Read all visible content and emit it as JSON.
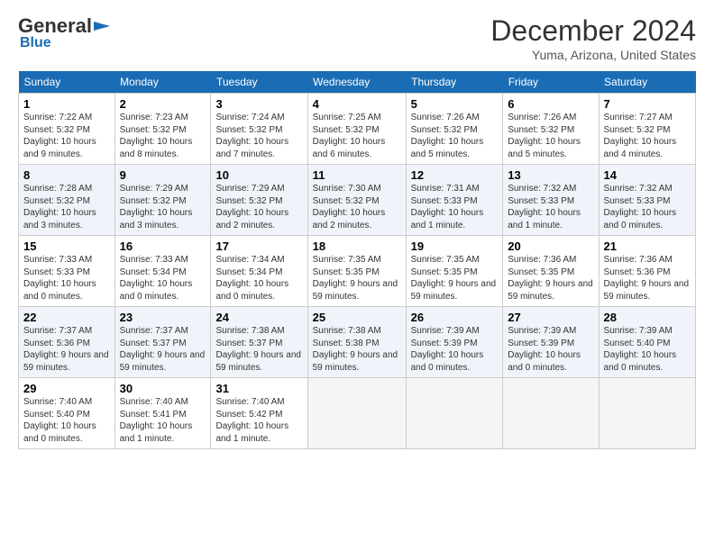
{
  "logo": {
    "general": "General",
    "blue": "Blue"
  },
  "title": "December 2024",
  "location": "Yuma, Arizona, United States",
  "days_of_week": [
    "Sunday",
    "Monday",
    "Tuesday",
    "Wednesday",
    "Thursday",
    "Friday",
    "Saturday"
  ],
  "weeks": [
    [
      {
        "day": "1",
        "sunrise": "7:22 AM",
        "sunset": "5:32 PM",
        "daylight": "10 hours and 9 minutes."
      },
      {
        "day": "2",
        "sunrise": "7:23 AM",
        "sunset": "5:32 PM",
        "daylight": "10 hours and 8 minutes."
      },
      {
        "day": "3",
        "sunrise": "7:24 AM",
        "sunset": "5:32 PM",
        "daylight": "10 hours and 7 minutes."
      },
      {
        "day": "4",
        "sunrise": "7:25 AM",
        "sunset": "5:32 PM",
        "daylight": "10 hours and 6 minutes."
      },
      {
        "day": "5",
        "sunrise": "7:26 AM",
        "sunset": "5:32 PM",
        "daylight": "10 hours and 5 minutes."
      },
      {
        "day": "6",
        "sunrise": "7:26 AM",
        "sunset": "5:32 PM",
        "daylight": "10 hours and 5 minutes."
      },
      {
        "day": "7",
        "sunrise": "7:27 AM",
        "sunset": "5:32 PM",
        "daylight": "10 hours and 4 minutes."
      }
    ],
    [
      {
        "day": "8",
        "sunrise": "7:28 AM",
        "sunset": "5:32 PM",
        "daylight": "10 hours and 3 minutes."
      },
      {
        "day": "9",
        "sunrise": "7:29 AM",
        "sunset": "5:32 PM",
        "daylight": "10 hours and 3 minutes."
      },
      {
        "day": "10",
        "sunrise": "7:29 AM",
        "sunset": "5:32 PM",
        "daylight": "10 hours and 2 minutes."
      },
      {
        "day": "11",
        "sunrise": "7:30 AM",
        "sunset": "5:32 PM",
        "daylight": "10 hours and 2 minutes."
      },
      {
        "day": "12",
        "sunrise": "7:31 AM",
        "sunset": "5:33 PM",
        "daylight": "10 hours and 1 minute."
      },
      {
        "day": "13",
        "sunrise": "7:32 AM",
        "sunset": "5:33 PM",
        "daylight": "10 hours and 1 minute."
      },
      {
        "day": "14",
        "sunrise": "7:32 AM",
        "sunset": "5:33 PM",
        "daylight": "10 hours and 0 minutes."
      }
    ],
    [
      {
        "day": "15",
        "sunrise": "7:33 AM",
        "sunset": "5:33 PM",
        "daylight": "10 hours and 0 minutes."
      },
      {
        "day": "16",
        "sunrise": "7:33 AM",
        "sunset": "5:34 PM",
        "daylight": "10 hours and 0 minutes."
      },
      {
        "day": "17",
        "sunrise": "7:34 AM",
        "sunset": "5:34 PM",
        "daylight": "10 hours and 0 minutes."
      },
      {
        "day": "18",
        "sunrise": "7:35 AM",
        "sunset": "5:35 PM",
        "daylight": "9 hours and 59 minutes."
      },
      {
        "day": "19",
        "sunrise": "7:35 AM",
        "sunset": "5:35 PM",
        "daylight": "9 hours and 59 minutes."
      },
      {
        "day": "20",
        "sunrise": "7:36 AM",
        "sunset": "5:35 PM",
        "daylight": "9 hours and 59 minutes."
      },
      {
        "day": "21",
        "sunrise": "7:36 AM",
        "sunset": "5:36 PM",
        "daylight": "9 hours and 59 minutes."
      }
    ],
    [
      {
        "day": "22",
        "sunrise": "7:37 AM",
        "sunset": "5:36 PM",
        "daylight": "9 hours and 59 minutes."
      },
      {
        "day": "23",
        "sunrise": "7:37 AM",
        "sunset": "5:37 PM",
        "daylight": "9 hours and 59 minutes."
      },
      {
        "day": "24",
        "sunrise": "7:38 AM",
        "sunset": "5:37 PM",
        "daylight": "9 hours and 59 minutes."
      },
      {
        "day": "25",
        "sunrise": "7:38 AM",
        "sunset": "5:38 PM",
        "daylight": "9 hours and 59 minutes."
      },
      {
        "day": "26",
        "sunrise": "7:39 AM",
        "sunset": "5:39 PM",
        "daylight": "10 hours and 0 minutes."
      },
      {
        "day": "27",
        "sunrise": "7:39 AM",
        "sunset": "5:39 PM",
        "daylight": "10 hours and 0 minutes."
      },
      {
        "day": "28",
        "sunrise": "7:39 AM",
        "sunset": "5:40 PM",
        "daylight": "10 hours and 0 minutes."
      }
    ],
    [
      {
        "day": "29",
        "sunrise": "7:40 AM",
        "sunset": "5:40 PM",
        "daylight": "10 hours and 0 minutes."
      },
      {
        "day": "30",
        "sunrise": "7:40 AM",
        "sunset": "5:41 PM",
        "daylight": "10 hours and 1 minute."
      },
      {
        "day": "31",
        "sunrise": "7:40 AM",
        "sunset": "5:42 PM",
        "daylight": "10 hours and 1 minute."
      },
      null,
      null,
      null,
      null
    ]
  ],
  "labels": {
    "sunrise": "Sunrise:",
    "sunset": "Sunset:",
    "daylight": "Daylight:"
  }
}
